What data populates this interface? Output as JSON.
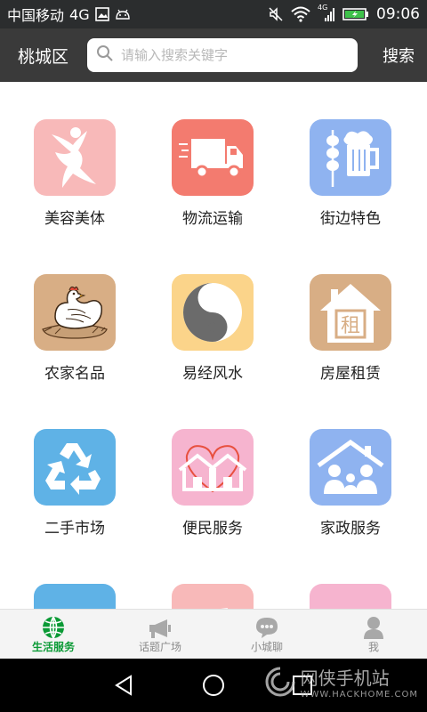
{
  "status_bar": {
    "carrier": "中国移动",
    "network": "4G",
    "signal_type": "4G",
    "time": "09:06"
  },
  "header": {
    "district": "桃城区",
    "search_placeholder": "请输入搜索关键字",
    "search_value": "",
    "search_button": "搜索"
  },
  "categories": [
    {
      "label": "美容美体",
      "icon": "dancer-icon",
      "color": "#f8b9b9"
    },
    {
      "label": "物流运输",
      "icon": "truck-icon",
      "color": "#f37b6f"
    },
    {
      "label": "街边特色",
      "icon": "beer-skewer-icon",
      "color": "#8fb3f0"
    },
    {
      "label": "农家名品",
      "icon": "hen-icon",
      "color": "#d8ae85"
    },
    {
      "label": "易经风水",
      "icon": "yin-yang-icon",
      "color": "#fbd48a"
    },
    {
      "label": "房屋租赁",
      "icon": "house-rent-icon",
      "color": "#d8ae85"
    },
    {
      "label": "二手市场",
      "icon": "recycle-icon",
      "color": "#5fb2e6"
    },
    {
      "label": "便民服务",
      "icon": "heart-house-icon",
      "color": "#f6b4cf"
    },
    {
      "label": "家政服务",
      "icon": "family-house-icon",
      "color": "#8fb3f0"
    },
    {
      "label": "",
      "icon": "partial-icon",
      "color": "#5fb2e6"
    },
    {
      "label": "",
      "icon": "partial-icon",
      "color": "#f8b9b9"
    },
    {
      "label": "",
      "icon": "partial-icon",
      "color": "#f6b4cf"
    }
  ],
  "tabs": [
    {
      "label": "生活服务",
      "icon": "globe-icon",
      "active": true
    },
    {
      "label": "话题广场",
      "icon": "megaphone-icon",
      "active": false
    },
    {
      "label": "小城聊",
      "icon": "chat-bubble-icon",
      "active": false
    },
    {
      "label": "我",
      "icon": "person-icon",
      "active": false
    }
  ],
  "watermark": {
    "title": "网侠手机站",
    "url": "WWW.HACKHOME.COM"
  }
}
